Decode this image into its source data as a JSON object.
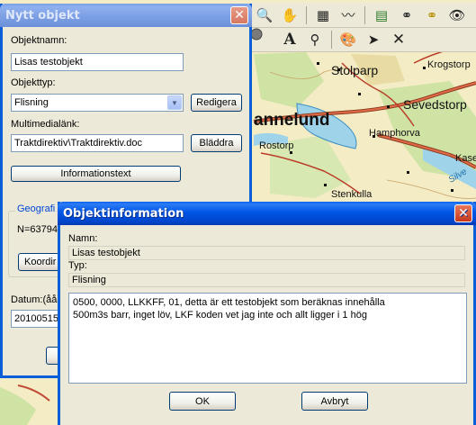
{
  "toolbar_top": {
    "icons": [
      "zoom-icon",
      "hand-pan-icon",
      "measure-icon",
      "curve-icon",
      "layer-icon",
      "binoculars-icon",
      "binoculars-area-icon",
      "eye-icon"
    ]
  },
  "toolbar_second": {
    "icons": [
      "circle-icon",
      "text-tool-icon",
      "pin-icon",
      "palette-icon",
      "pointer-icon",
      "delete-x-icon"
    ]
  },
  "map": {
    "labels": [
      "Stolparp",
      "Krogstorp",
      "Sevedstorp",
      "annelund",
      "Hamphorva",
      "Rostorp",
      "Kasel",
      "Silve",
      "Stenkulla"
    ]
  },
  "nytt_objekt": {
    "title": "Nytt objekt",
    "objektnamn_label": "Objektnamn:",
    "objektnamn_value": "Lisas testobjekt",
    "objekttyp_label": "Objekttyp:",
    "objekttyp_value": "Flisning",
    "redigera_button": "Redigera",
    "multimedialank_label": "Multimedialänk:",
    "multimedialank_value": "Traktdirektiv\\Traktdirektiv.doc",
    "bladdra_button": "Bläddra",
    "informationstext_button": "Informationstext",
    "geografi_label": "Geografi",
    "n_value": "N=63794",
    "koordinat_button": "Koordir",
    "datum_label": "Datum:(ååå",
    "datum_value": "20100515"
  },
  "objektinformation": {
    "title": "Objektinformation",
    "namn_label": "Namn:",
    "namn_value": "Lisas testobjekt",
    "typ_label": "Typ:",
    "typ_value": "Flisning",
    "memo_text": "0500, 0000, LLKKFF, 01, detta är ett testobjekt som beräknas innehålla\n500m3s barr, inget löv, LKF koden vet jag inte och allt ligger i 1 hög",
    "ok_button": "OK",
    "avbryt_button": "Avbryt"
  },
  "colors": {
    "title_blue": "#0055e5",
    "window_face": "#ece9d8",
    "close_red": "#d24b2c"
  }
}
